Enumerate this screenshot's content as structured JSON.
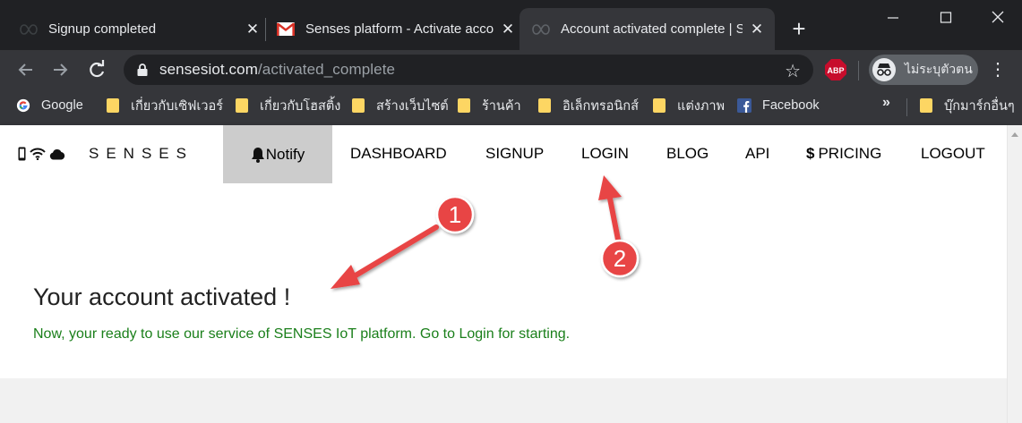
{
  "browser": {
    "tabs": [
      {
        "title": "Signup completed",
        "favicon": "infinity-icon",
        "active": false
      },
      {
        "title": "Senses platform - Activate account",
        "favicon": "gmail-icon",
        "active": false
      },
      {
        "title": "Account activated complete | SENSES",
        "favicon": "infinity-icon",
        "active": true
      }
    ],
    "address": {
      "domain": "sensesiot.com",
      "path": "/activated_complete"
    },
    "extension_label": "ABP",
    "profile_name": "ไม่ระบุตัวตน",
    "bookmarks": [
      {
        "label": "Google",
        "icon": "google-icon"
      },
      {
        "label": "เกี่ยวกับเซิฟเวอร์",
        "icon": "folder-icon"
      },
      {
        "label": "เกี่ยวกับโฮสติ้ง",
        "icon": "folder-icon"
      },
      {
        "label": "สร้างเว็บไซต์",
        "icon": "folder-icon"
      },
      {
        "label": "ร้านค้า",
        "icon": "folder-icon"
      },
      {
        "label": "อิเล็กทรอนิกส์",
        "icon": "folder-icon"
      },
      {
        "label": "แต่งภาพ",
        "icon": "folder-icon"
      },
      {
        "label": "Facebook",
        "icon": "facebook-icon"
      }
    ],
    "bookmarks_overflow": "»",
    "other_bookmarks": "บุ๊กมาร์กอื่นๆ"
  },
  "site": {
    "brand": "SENSES",
    "notify": "Notify",
    "nav": [
      {
        "label": "DASHBOARD"
      },
      {
        "label": "SIGNUP"
      },
      {
        "label": "LOGIN"
      },
      {
        "label": "BLOG"
      },
      {
        "label": "API"
      },
      {
        "label": "PRICING",
        "prefix": "$"
      },
      {
        "label": "LOGOUT"
      }
    ]
  },
  "content": {
    "heading": "Your account activated !",
    "message": "Now, your ready to use our service of SENSES IoT platform. Go to Login for starting."
  },
  "annotations": [
    {
      "label": "1"
    },
    {
      "label": "2"
    }
  ],
  "colors": {
    "tab_strip": "#202124",
    "toolbar": "#35363a",
    "notify_bg": "#cccccc",
    "message_text": "#1a7f1a",
    "annotation": "#e84545"
  }
}
